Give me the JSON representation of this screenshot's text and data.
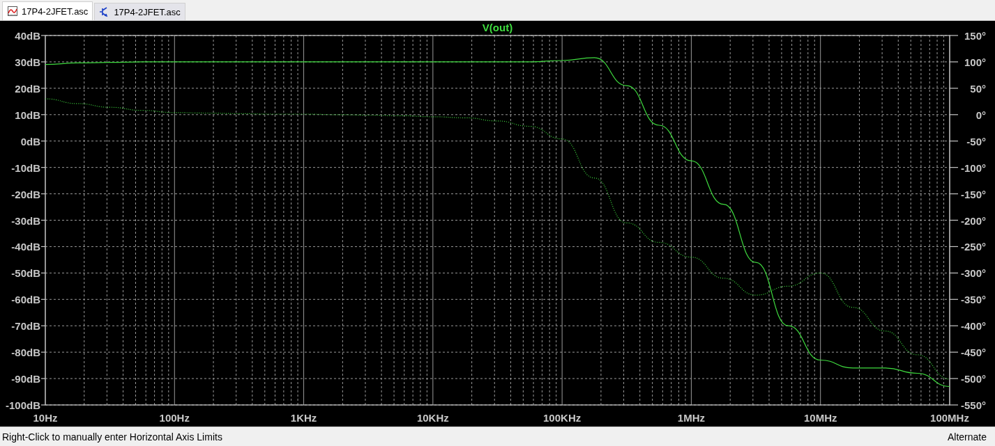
{
  "tabs": [
    {
      "label": "17P4-2JFET.asc",
      "kind": "waveform",
      "selected": true
    },
    {
      "label": "17P4-2JFET.asc",
      "kind": "schematic",
      "selected": false
    }
  ],
  "plot": {
    "chart_data": {
      "type": "line",
      "title": "V(out)",
      "grid": true,
      "ylim": [
        -100,
        40
      ],
      "y2lim": [
        -550,
        150
      ],
      "categories": [
        "10Hz",
        null,
        null,
        null,
        "100Hz",
        null,
        null,
        null,
        "1KHz",
        null,
        null,
        null,
        "10KHz",
        null,
        null,
        null,
        "100KHz",
        null,
        null,
        null,
        "1MHz",
        null,
        null,
        null,
        "10MHz",
        null,
        null,
        null,
        "100MHz"
      ],
      "yticks": [
        {
          "value": 40,
          "label": "40dB"
        },
        {
          "value": 30,
          "label": "30dB"
        },
        {
          "value": 20,
          "label": "20dB"
        },
        {
          "value": 10,
          "label": "10dB"
        },
        {
          "value": 0,
          "label": "0dB"
        },
        {
          "value": -10,
          "label": "-10dB"
        },
        {
          "value": -20,
          "label": "-20dB"
        },
        {
          "value": -30,
          "label": "-30dB"
        },
        {
          "value": -40,
          "label": "-40dB"
        },
        {
          "value": -50,
          "label": "-50dB"
        },
        {
          "value": -60,
          "label": "-60dB"
        },
        {
          "value": -70,
          "label": "-70dB"
        },
        {
          "value": -80,
          "label": "-80dB"
        },
        {
          "value": -90,
          "label": "-90dB"
        },
        {
          "value": -100,
          "label": "-100dB"
        }
      ],
      "y2ticks": [
        {
          "value": 150,
          "label": "150°"
        },
        {
          "value": 100,
          "label": "100°"
        },
        {
          "value": 50,
          "label": "50°"
        },
        {
          "value": 0,
          "label": "0°"
        },
        {
          "value": -50,
          "label": "-50°"
        },
        {
          "value": -100,
          "label": "-100°"
        },
        {
          "value": -150,
          "label": "-150°"
        },
        {
          "value": -200,
          "label": "-200°"
        },
        {
          "value": -250,
          "label": "-250°"
        },
        {
          "value": -300,
          "label": "-300°"
        },
        {
          "value": -350,
          "label": "-350°"
        },
        {
          "value": -400,
          "label": "-400°"
        },
        {
          "value": -450,
          "label": "-450°"
        },
        {
          "value": -500,
          "label": "-500°"
        },
        {
          "value": -550,
          "label": "-550°"
        }
      ],
      "series": [
        {
          "line_style": "solid",
          "color": "#3fdc3f",
          "values": [
            29,
            29.6,
            29.8,
            30,
            30,
            30,
            30,
            30,
            30,
            30,
            30,
            30,
            30,
            30,
            30,
            30,
            30.5,
            31.6,
            21,
            6,
            -7.5,
            -24,
            -46,
            -70,
            -83,
            -86,
            -86,
            -88,
            -93
          ]
        },
        {
          "axis": "y2",
          "line_style": "dotted",
          "color": "#3fdc3f",
          "values": [
            30,
            21,
            14,
            8,
            4,
            3,
            2,
            1,
            1,
            0,
            -1,
            -2,
            -4,
            -6,
            -12,
            -22,
            -46,
            -120,
            -205,
            -242,
            -270,
            -310,
            -342,
            -325,
            -300,
            -365,
            -410,
            -455,
            -501
          ]
        }
      ]
    }
  },
  "status_bar": {
    "hint": "Right-Click to manually enter Horizontal Axis Limits",
    "mode": "Alternate"
  }
}
